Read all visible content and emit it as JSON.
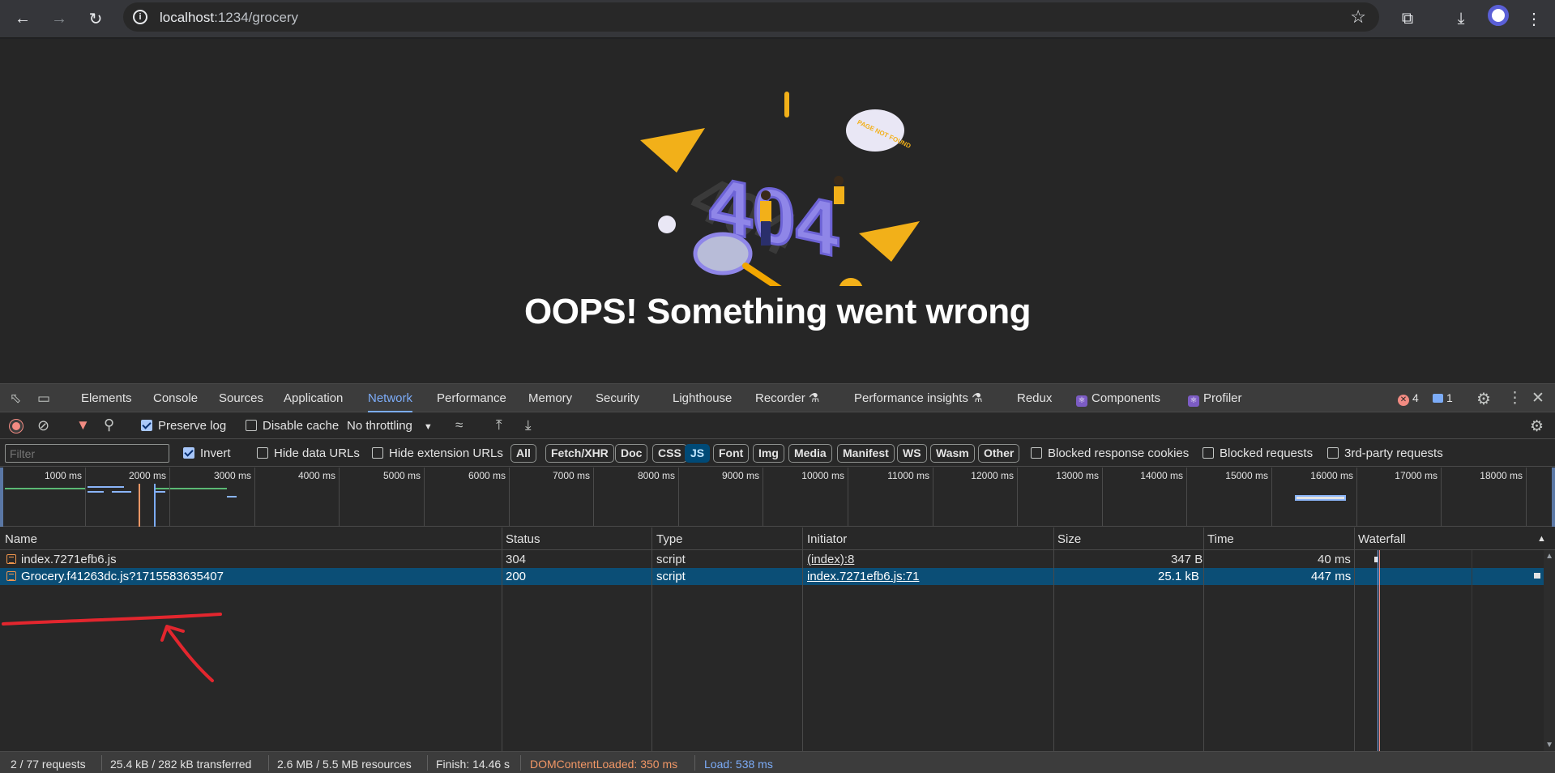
{
  "browser": {
    "url_host": "localhost",
    "url_path": ":1234/grocery"
  },
  "page": {
    "heading": "OOPS! Something went wrong",
    "illustration": {
      "big_text": "404",
      "shadow_text": "404",
      "bubble_text": "PAGE NOT FOUND"
    }
  },
  "devtools": {
    "tabs": [
      {
        "label": "Elements"
      },
      {
        "label": "Console"
      },
      {
        "label": "Sources"
      },
      {
        "label": "Application"
      },
      {
        "label": "Network"
      },
      {
        "label": "Performance"
      },
      {
        "label": "Memory"
      },
      {
        "label": "Security"
      },
      {
        "label": "Lighthouse"
      },
      {
        "label": "Recorder ⚗"
      },
      {
        "label": "Performance insights ⚗"
      },
      {
        "label": "Redux"
      },
      {
        "label": "Components"
      },
      {
        "label": "Profiler"
      }
    ],
    "active_tab": "Network",
    "error_count": "4",
    "issue_count": "1",
    "toolbar": {
      "preserve_log": "Preserve log",
      "disable_cache": "Disable cache",
      "throttling": "No throttling"
    },
    "filter": {
      "placeholder": "Filter",
      "invert": "Invert",
      "hide_data_urls": "Hide data URLs",
      "hide_extension_urls": "Hide extension URLs",
      "types": [
        "All",
        "Fetch/XHR",
        "Doc",
        "CSS",
        "JS",
        "Font",
        "Img",
        "Media",
        "Manifest",
        "WS",
        "Wasm",
        "Other"
      ],
      "active_type": "JS",
      "blocked_response_cookies": "Blocked response cookies",
      "blocked_requests": "Blocked requests",
      "third_party": "3rd-party requests"
    },
    "overview_ticks": [
      "1000 ms",
      "2000 ms",
      "3000 ms",
      "4000 ms",
      "5000 ms",
      "6000 ms",
      "7000 ms",
      "8000 ms",
      "9000 ms",
      "10000 ms",
      "11000 ms",
      "12000 ms",
      "13000 ms",
      "14000 ms",
      "15000 ms",
      "16000 ms",
      "17000 ms",
      "18000 ms"
    ],
    "columns": [
      "Name",
      "Status",
      "Type",
      "Initiator",
      "Size",
      "Time",
      "Waterfall"
    ],
    "requests": [
      {
        "name": "index.7271efb6.js",
        "status": "304",
        "type": "script",
        "initiator": "(index):8",
        "size": "347 B",
        "time": "40 ms"
      },
      {
        "name": "Grocery.f41263dc.js?1715583635407",
        "status": "200",
        "type": "script",
        "initiator": "index.7271efb6.js:71",
        "size": "25.1 kB",
        "time": "447 ms"
      }
    ],
    "status_bar": {
      "requests": "2 / 77 requests",
      "transferred": "25.4 kB / 282 kB transferred",
      "resources": "2.6 MB / 5.5 MB resources",
      "finish": "Finish: 14.46 s",
      "dom_content_loaded": "DOMContentLoaded: 350 ms",
      "load": "Load: 538 ms"
    }
  },
  "colors": {
    "accent": "#7cacf8",
    "selected_row": "#0b4e76",
    "dcl": "#f29766",
    "load": "#7cacf8",
    "annotation": "#e3262e"
  }
}
